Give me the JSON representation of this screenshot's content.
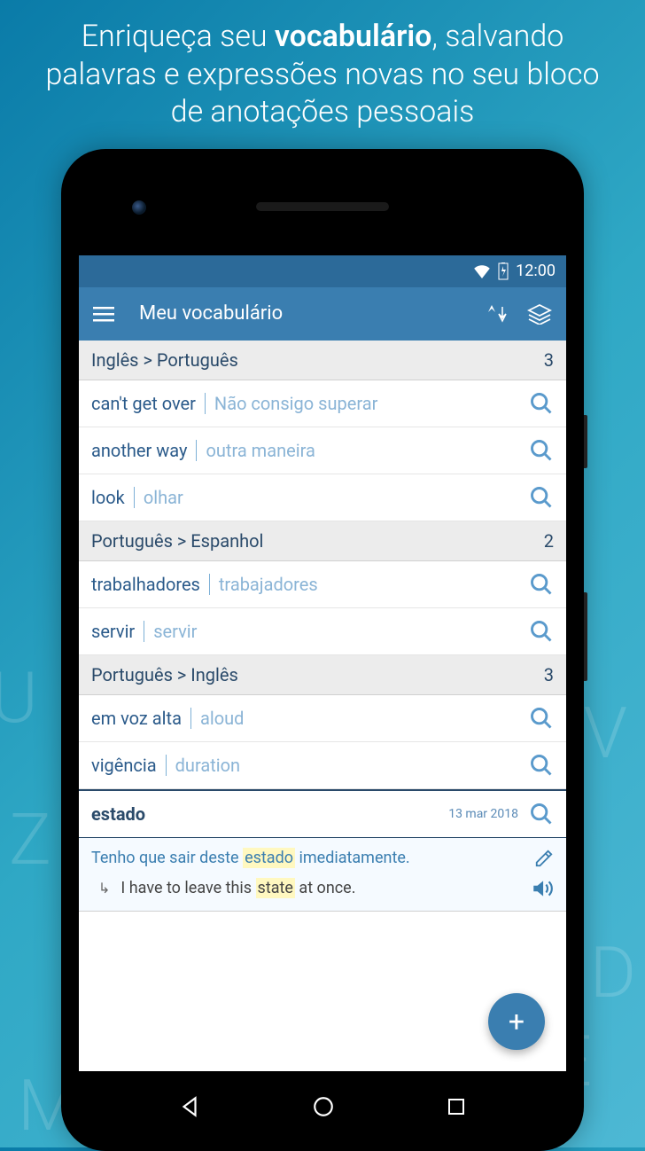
{
  "promo": {
    "before": "Enriqueça seu ",
    "bold": "vocabulário",
    "after": ", salvando palavras e expressões novas no seu bloco de anotações pessoais"
  },
  "status": {
    "time": "12:00"
  },
  "appbar": {
    "title": "Meu vocabulário"
  },
  "sections": [
    {
      "title": "Inglês > Português",
      "count": "3"
    },
    {
      "title": "Português > Espanhol",
      "count": "2"
    },
    {
      "title": "Português > Inglês",
      "count": "3"
    }
  ],
  "items_en_pt": [
    {
      "source": "can't get over",
      "target": "Não consigo superar"
    },
    {
      "source": "another way",
      "target": "outra maneira"
    },
    {
      "source": "look",
      "target": "olhar"
    }
  ],
  "items_pt_es": [
    {
      "source": "trabalhadores",
      "target": "trabajadores"
    },
    {
      "source": "servir",
      "target": "servir"
    }
  ],
  "items_pt_en": [
    {
      "source": "em voz alta",
      "target": "aloud"
    },
    {
      "source": "vigência",
      "target": "duration"
    }
  ],
  "selected": {
    "word": "estado",
    "date": "13 mar 2018",
    "sentence_before": "Tenho que sair deste ",
    "sentence_hl": "estado",
    "sentence_after": " imediatamente.",
    "translation_before": "I have to leave this ",
    "translation_hl": "state",
    "translation_after": " at once."
  },
  "fab": {
    "label": "+"
  }
}
